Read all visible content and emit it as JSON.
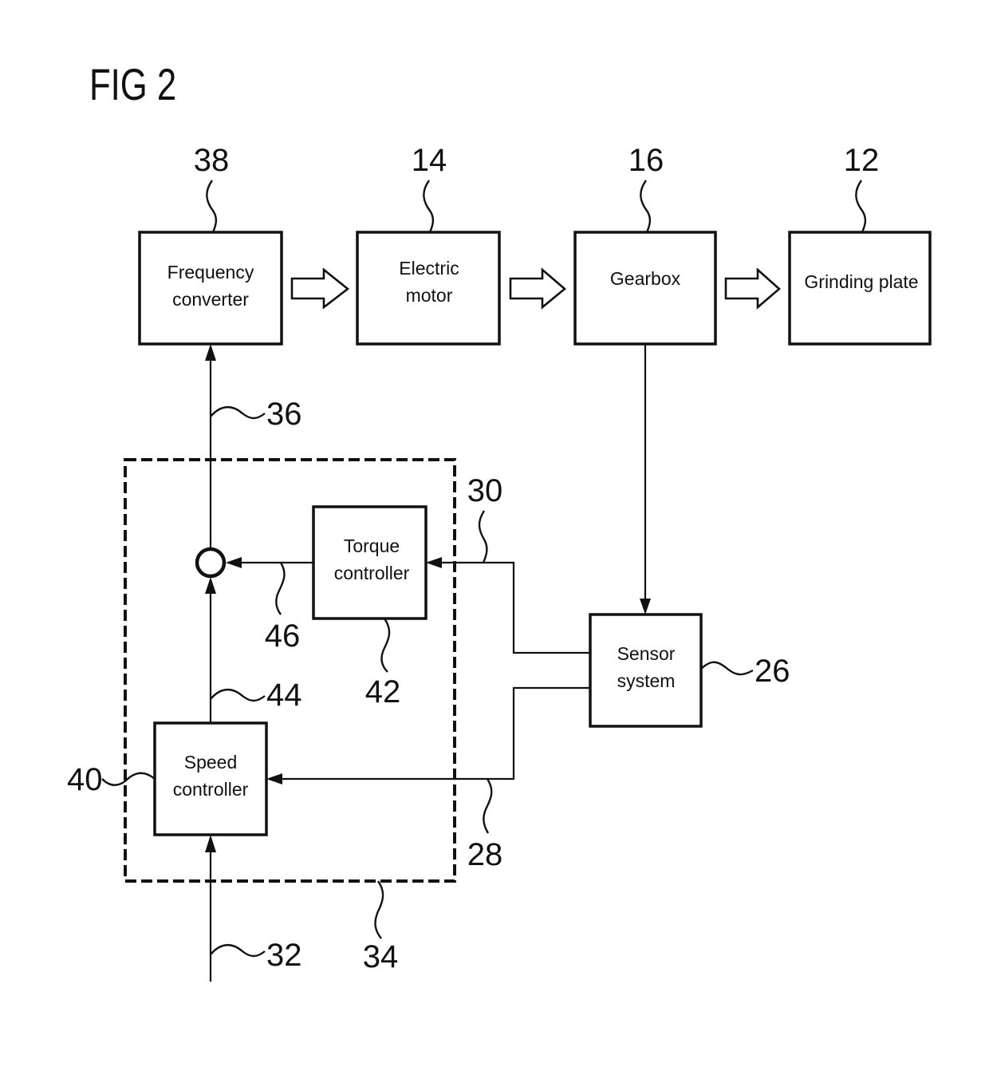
{
  "figure": {
    "title": "FIG 2"
  },
  "blocks": {
    "frequency_converter": {
      "ref": "38",
      "lines": [
        "Frequency",
        "converter"
      ]
    },
    "electric_motor": {
      "ref": "14",
      "lines": [
        "Electric",
        "motor"
      ]
    },
    "gearbox": {
      "ref": "16",
      "lines": [
        "Gearbox"
      ]
    },
    "grinding_plate": {
      "ref": "12",
      "lines": [
        "Grinding plate"
      ]
    },
    "torque_controller": {
      "ref": "42",
      "lines": [
        "Torque",
        "controller"
      ]
    },
    "speed_controller": {
      "ref": "40",
      "lines": [
        "Speed",
        "controller"
      ]
    },
    "sensor_system": {
      "ref": "26",
      "lines": [
        "Sensor",
        "system"
      ]
    }
  },
  "signals": {
    "control_output": "36",
    "torque_signal_in": "30",
    "torque_controller_out": "46",
    "speed_controller_out": "44",
    "speed_signal_in": "28",
    "speed_setpoint": "32",
    "controller_unit": "34"
  },
  "edges": [
    {
      "from": "frequency_converter",
      "to": "electric_motor",
      "style": "hollow-arrow"
    },
    {
      "from": "electric_motor",
      "to": "gearbox",
      "style": "hollow-arrow"
    },
    {
      "from": "gearbox",
      "to": "grinding_plate",
      "style": "hollow-arrow"
    },
    {
      "from": "gearbox",
      "to": "sensor_system",
      "style": "arrow"
    },
    {
      "from": "sensor_system",
      "to": "torque_controller",
      "label": "30"
    },
    {
      "from": "sensor_system",
      "to": "speed_controller",
      "label": "28"
    },
    {
      "from": "torque_controller",
      "to": "summing_point",
      "label": "46"
    },
    {
      "from": "speed_controller",
      "to": "summing_point",
      "label": "44"
    },
    {
      "from": "summing_point",
      "to": "frequency_converter",
      "label": "36"
    },
    {
      "from": "input",
      "to": "speed_controller",
      "label": "32"
    }
  ]
}
